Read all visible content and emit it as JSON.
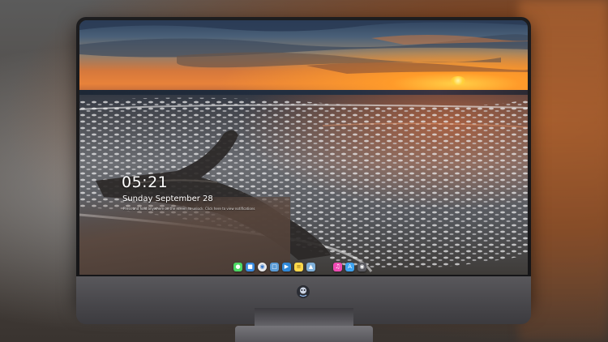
{
  "lock_screen": {
    "time": "05:21",
    "date": "Sunday September 28",
    "notice": "Press and hold anywhere on the screen to unlock. Click here to view notifications"
  },
  "dock": {
    "icons": [
      {
        "name": "messages-icon",
        "color": "#4cd964"
      },
      {
        "name": "finder-icon",
        "color": "#3a8be0"
      },
      {
        "name": "safari-icon",
        "color": "#e8e8ea"
      },
      {
        "name": "files-icon",
        "color": "#5b9bd5"
      },
      {
        "name": "video-icon",
        "color": "#2f88d8"
      },
      {
        "name": "notes-icon",
        "color": "#ffd84a"
      },
      {
        "name": "photos-icon",
        "color": "#7fb0d9"
      },
      {
        "name": "music-icon",
        "color": "#f04bb5"
      },
      {
        "name": "app-store-icon",
        "color": "#3ea3f0"
      },
      {
        "name": "camera-icon",
        "color": "#5a5a60"
      }
    ]
  }
}
